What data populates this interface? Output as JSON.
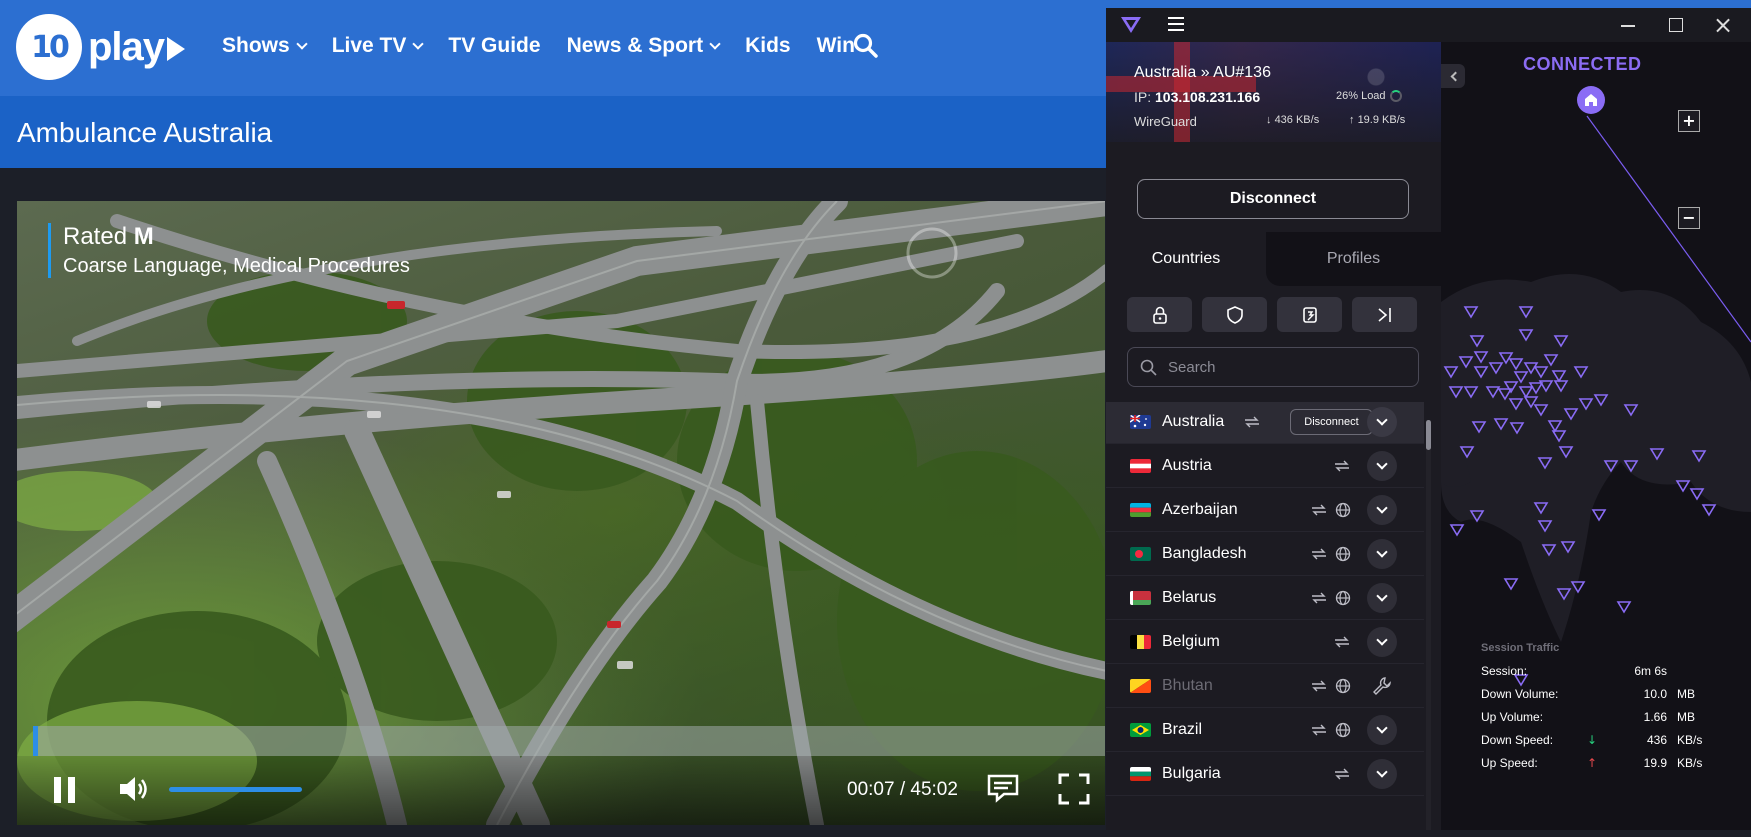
{
  "site": {
    "logo_badge": "10",
    "logo_text": "play",
    "nav": [
      {
        "label": "Shows",
        "dropdown": true
      },
      {
        "label": "Live TV",
        "dropdown": true
      },
      {
        "label": "TV Guide",
        "dropdown": false
      },
      {
        "label": "News & Sport",
        "dropdown": true
      },
      {
        "label": "Kids",
        "dropdown": false
      },
      {
        "label": "Win",
        "dropdown": false
      }
    ],
    "search_icon": "search-icon",
    "show_title": "Ambulance Australia",
    "colors": {
      "nav_bg": "#2c6fd1",
      "title_bar": "#1b62c6",
      "accent": "#2d8ee6"
    }
  },
  "player": {
    "rating_prefix": "Rated ",
    "rating_value": "M",
    "rating_desc": "Coarse Language, Medical Procedures",
    "time": "00:07 / 45:02",
    "progress": 0.0026,
    "volume": 1.0
  },
  "vpn": {
    "server": "Australia » AU#136",
    "ip_label": "IP: ",
    "ip": "103.108.231.166",
    "load": "26% Load",
    "protocol": "WireGuard",
    "download": "436 KB/s",
    "upload": "19.9 KB/s",
    "disconnect_label": "Disconnect",
    "tabs": {
      "countries": "Countries",
      "profiles": "Profiles"
    },
    "filter_icons": [
      "lock-icon",
      "shield-icon",
      "p2p-icon",
      "tor-icon"
    ],
    "search_placeholder": "Search",
    "row_disconnect_label": "Disconnect",
    "countries": [
      {
        "name": "Australia",
        "active": true,
        "repeat": true,
        "globe": false,
        "state": "expand"
      },
      {
        "name": "Austria",
        "active": false,
        "repeat": true,
        "globe": false,
        "state": "expand"
      },
      {
        "name": "Azerbaijan",
        "active": false,
        "repeat": true,
        "globe": true,
        "state": "expand"
      },
      {
        "name": "Bangladesh",
        "active": false,
        "repeat": true,
        "globe": true,
        "state": "expand"
      },
      {
        "name": "Belarus",
        "active": false,
        "repeat": true,
        "globe": true,
        "state": "expand"
      },
      {
        "name": "Belgium",
        "active": false,
        "repeat": true,
        "globe": false,
        "state": "expand"
      },
      {
        "name": "Bhutan",
        "active": false,
        "repeat": true,
        "globe": true,
        "state": "maintenance"
      },
      {
        "name": "Brazil",
        "active": false,
        "repeat": true,
        "globe": true,
        "state": "expand"
      },
      {
        "name": "Bulgaria",
        "active": false,
        "repeat": true,
        "globe": false,
        "state": "expand"
      }
    ],
    "status": "CONNECTED",
    "zoom_in": "+",
    "zoom_out": "−",
    "session": {
      "title": "Session Traffic",
      "rows": [
        {
          "label": "Session:",
          "value": "6m 6s",
          "unit": "",
          "arrow": ""
        },
        {
          "label": "Down Volume:",
          "value": "10.0",
          "unit": "MB",
          "arrow": ""
        },
        {
          "label": "Up Volume:",
          "value": "1.66",
          "unit": "MB",
          "arrow": ""
        },
        {
          "label": "Down Speed:",
          "value": "436",
          "unit": "KB/s",
          "arrow": "↓"
        },
        {
          "label": "Up Speed:",
          "value": "19.9",
          "unit": "KB/s",
          "arrow": "↑"
        }
      ]
    },
    "colors": {
      "accent": "#8a6cf5",
      "down_arrow": "#27d07e",
      "up_arrow": "#e5484d"
    }
  }
}
